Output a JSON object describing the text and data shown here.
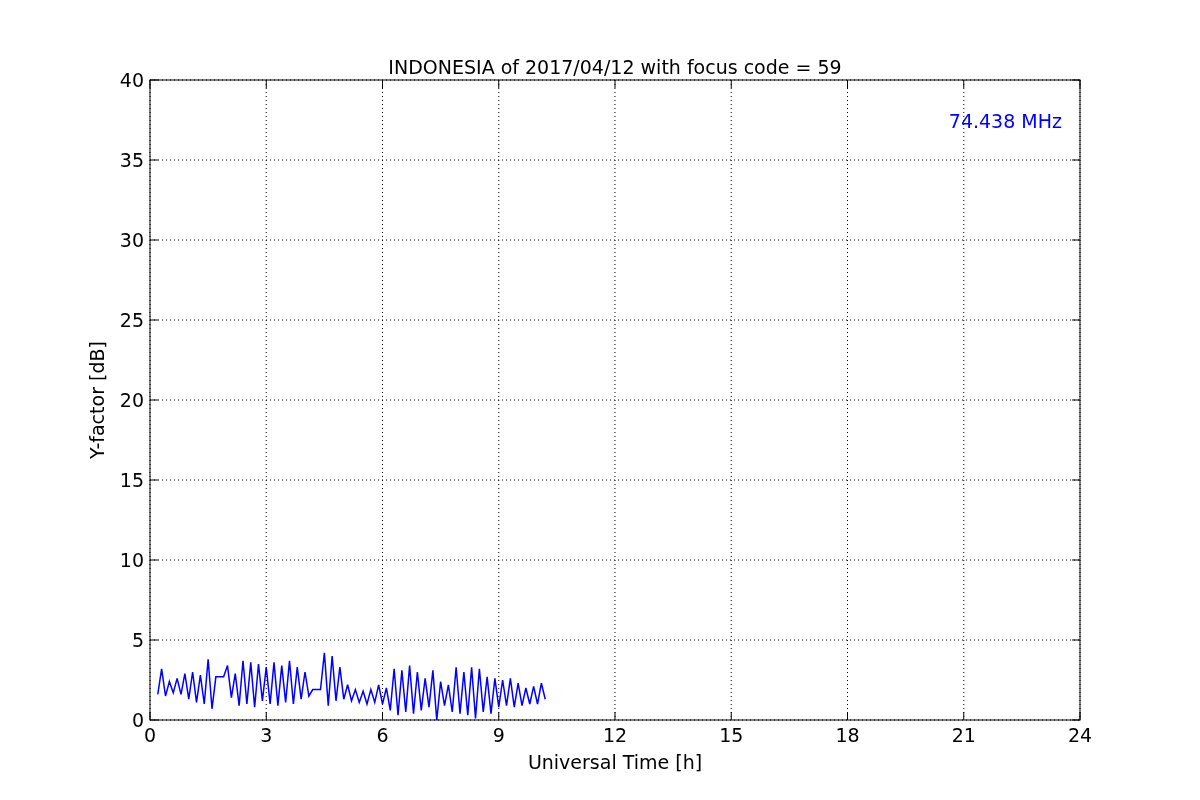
{
  "chart_data": {
    "type": "line",
    "title": "INDONESIA of 2017/04/12 with focus code = 59",
    "xlabel": "Universal Time [h]",
    "ylabel": "Y-factor [dB]",
    "xlim": [
      0,
      24
    ],
    "ylim": [
      0,
      40
    ],
    "xticks": [
      0,
      3,
      6,
      9,
      12,
      15,
      18,
      21,
      24
    ],
    "yticks": [
      0,
      5,
      10,
      15,
      20,
      25,
      30,
      35,
      40
    ],
    "x": [
      0.2,
      0.3,
      0.4,
      0.5,
      0.6,
      0.7,
      0.8,
      0.9,
      1.0,
      1.1,
      1.2,
      1.3,
      1.4,
      1.5,
      1.6,
      1.7,
      1.8,
      1.9,
      2.0,
      2.1,
      2.2,
      2.3,
      2.4,
      2.5,
      2.6,
      2.7,
      2.8,
      2.9,
      3.0,
      3.1,
      3.2,
      3.3,
      3.4,
      3.5,
      3.6,
      3.7,
      3.8,
      3.9,
      4.0,
      4.1,
      4.2,
      4.3,
      4.4,
      4.5,
      4.6,
      4.7,
      4.8,
      4.9,
      5.0,
      5.1,
      5.2,
      5.3,
      5.4,
      5.5,
      5.6,
      5.7,
      5.8,
      5.9,
      6.0,
      6.1,
      6.2,
      6.3,
      6.4,
      6.5,
      6.6,
      6.7,
      6.8,
      6.9,
      7.0,
      7.1,
      7.2,
      7.3,
      7.4,
      7.5,
      7.6,
      7.7,
      7.8,
      7.9,
      8.0,
      8.1,
      8.2,
      8.3,
      8.4,
      8.5,
      8.6,
      8.7,
      8.8,
      8.9,
      9.0,
      9.1,
      9.2,
      9.3,
      9.4,
      9.5,
      9.6,
      9.7,
      9.8,
      9.9,
      10.0,
      10.1,
      10.2
    ],
    "series": [
      {
        "name": "74.438 MHz",
        "color": "#0000ff",
        "values": [
          1.6,
          3.2,
          1.5,
          2.4,
          1.7,
          2.6,
          1.6,
          2.9,
          1.3,
          3.0,
          1.1,
          2.8,
          1.0,
          3.8,
          0.7,
          2.7,
          2.7,
          2.7,
          3.4,
          1.4,
          2.9,
          0.9,
          3.7,
          1.0,
          3.6,
          0.8,
          3.5,
          1.2,
          3.3,
          1.0,
          3.6,
          0.9,
          3.4,
          1.1,
          3.7,
          1.0,
          3.3,
          1.3,
          3.0,
          1.5,
          1.9,
          1.9,
          1.9,
          4.2,
          0.9,
          4.0,
          1.2,
          3.3,
          1.3,
          2.2,
          1.2,
          1.9,
          1.1,
          1.8,
          1.0,
          1.9,
          1.1,
          2.2,
          1.0,
          2.0,
          0.6,
          3.2,
          0.3,
          3.1,
          0.5,
          3.4,
          0.4,
          3.0,
          0.6,
          2.6,
          0.8,
          3.1,
          0.0,
          2.4,
          0.9,
          2.2,
          0.5,
          3.3,
          0.4,
          3.0,
          0.3,
          3.3,
          0.1,
          3.2,
          0.5,
          2.7,
          0.4,
          2.6,
          0.8,
          2.5,
          0.9,
          2.6,
          0.8,
          2.3,
          0.9,
          2.0,
          1.0,
          2.1,
          1.0,
          2.3,
          1.3
        ]
      }
    ],
    "grid": true
  }
}
